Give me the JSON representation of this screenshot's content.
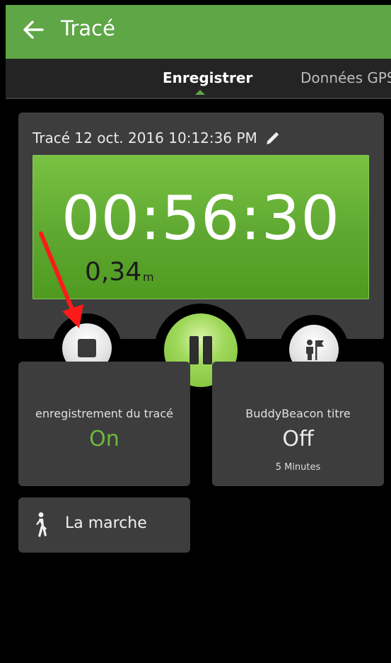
{
  "header": {
    "title": "Tracé",
    "back_icon": "arrow-left-icon"
  },
  "tabs": [
    {
      "label": "Enregistrer",
      "active": true
    },
    {
      "label": "Données GPS",
      "active": false
    }
  ],
  "track": {
    "title": "Tracé 12 oct. 2016 10:12:36 PM",
    "edit_icon": "pencil-icon",
    "timer": "00:56:30",
    "distance_value": "0,34",
    "distance_unit": "m"
  },
  "controls": {
    "stop_icon": "stop-icon",
    "pause_icon": "pause-icon",
    "buddy_icon": "buddy-flag-icon"
  },
  "recording": {
    "label": "enregistrement du tracé",
    "value": "On"
  },
  "buddy_beacon": {
    "label": "BuddyBeacon titre",
    "value": "Off",
    "interval": "5 Minutes"
  },
  "activity": {
    "label": "La marche",
    "icon": "walking-person-icon"
  },
  "colors": {
    "accent": "#5ea646",
    "card": "#3d3d3d",
    "on": "#6db93e",
    "annotation": "#ff1a1a"
  }
}
